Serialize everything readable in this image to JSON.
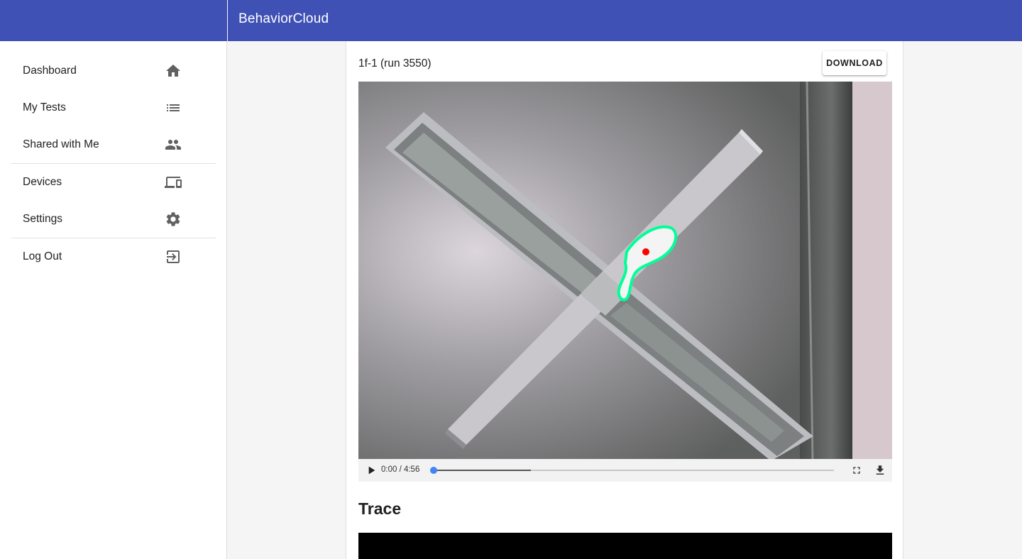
{
  "app": {
    "title": "BehaviorCloud",
    "colors": {
      "appbar": "#3f51b5",
      "drawer": "#ffffff",
      "background": "#f5f5f5",
      "tracking_outline": "#00ff99",
      "tracking_centroid": "#ff0000",
      "progress_knob": "#4285f4"
    }
  },
  "sidebar": {
    "items": [
      {
        "label": "Dashboard",
        "icon": "home-icon"
      },
      {
        "label": "My Tests",
        "icon": "list-icon"
      },
      {
        "label": "Shared with Me",
        "icon": "people-icon"
      },
      {
        "label": "Devices",
        "icon": "devices-icon"
      },
      {
        "label": "Settings",
        "icon": "gear-icon"
      },
      {
        "label": "Log Out",
        "icon": "exit-icon"
      }
    ]
  },
  "run": {
    "title": "1f-1 (run 3550)",
    "download_label": "DOWNLOAD"
  },
  "player": {
    "time_display": "0:00 / 4:56",
    "current_fraction": 0,
    "buffered_fraction": 0.243,
    "icons": [
      "play-icon",
      "fullscreen-icon",
      "download-icon"
    ]
  },
  "trace": {
    "heading": "Trace"
  }
}
